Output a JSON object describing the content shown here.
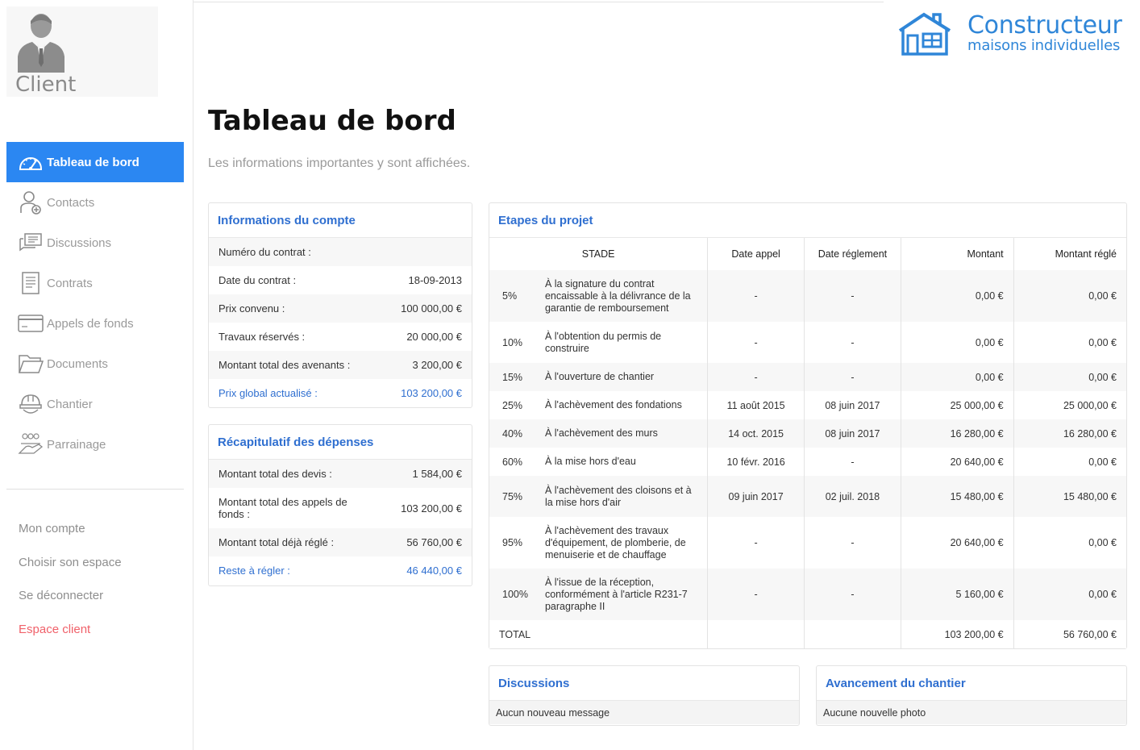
{
  "sidebar": {
    "profile_name": "Client",
    "nav": [
      {
        "label": "Tableau de bord",
        "icon": "speedometer-icon",
        "active": true
      },
      {
        "label": "Contacts",
        "icon": "user-add-icon"
      },
      {
        "label": "Discussions",
        "icon": "chat-icon"
      },
      {
        "label": "Contrats",
        "icon": "document-icon"
      },
      {
        "label": "Appels de fonds",
        "icon": "credit-card-icon"
      },
      {
        "label": "Documents",
        "icon": "folder-icon"
      },
      {
        "label": "Chantier",
        "icon": "helmet-icon"
      },
      {
        "label": "Parrainage",
        "icon": "handshake-icon"
      }
    ],
    "links": [
      {
        "label": "Mon compte"
      },
      {
        "label": "Choisir son espace"
      },
      {
        "label": "Se déconnecter"
      },
      {
        "label": "Espace client"
      }
    ]
  },
  "logo": {
    "line1": "Constructeur",
    "line2": "maisons individuelles",
    "color": "#2f86d8"
  },
  "header": {
    "title": "Tableau de bord",
    "subtitle": "Les informations importantes y sont affichées."
  },
  "account": {
    "title": "Informations du compte",
    "rows": [
      {
        "label": "Numéro du contrat :",
        "value": ""
      },
      {
        "label": "Date du contrat :",
        "value": "18-09-2013"
      },
      {
        "label": "Prix convenu :",
        "value": "100 000,00 €"
      },
      {
        "label": "Travaux réservés :",
        "value": "20 000,00 €"
      },
      {
        "label": "Montant total des avenants :",
        "value": "3 200,00 €"
      },
      {
        "label": "Prix global actualisé :",
        "value": "103 200,00 €"
      }
    ]
  },
  "expenses": {
    "title": "Récapitulatif des dépenses",
    "rows": [
      {
        "label": "Montant total des devis :",
        "value": "1 584,00 €"
      },
      {
        "label": "Montant total des appels de fonds :",
        "value": "103 200,00 €"
      },
      {
        "label": "Montant total déjà réglé :",
        "value": "56 760,00 €"
      },
      {
        "label": "Reste à régler :",
        "value": "46 440,00 €"
      }
    ]
  },
  "steps": {
    "title": "Etapes du projet",
    "headers": [
      "STADE",
      "Date appel",
      "Date réglement",
      "Montant",
      "Montant réglé"
    ],
    "rows": [
      {
        "pct": "5%",
        "stade": "À la signature du contrat encaissable à la délivrance de la garantie de remboursement",
        "date_appel": "-",
        "date_reglement": "-",
        "montant": "0,00 €",
        "regle": "0,00 €"
      },
      {
        "pct": "10%",
        "stade": "À l'obtention du permis de construire",
        "date_appel": "-",
        "date_reglement": "-",
        "montant": "0,00 €",
        "regle": "0,00 €"
      },
      {
        "pct": "15%",
        "stade": "À l'ouverture de chantier",
        "date_appel": "-",
        "date_reglement": "-",
        "montant": "0,00 €",
        "regle": "0,00 €"
      },
      {
        "pct": "25%",
        "stade": "À l'achèvement des fondations",
        "date_appel": "11 août 2015",
        "date_reglement": "08 juin 2017",
        "montant": "25 000,00 €",
        "regle": "25 000,00 €"
      },
      {
        "pct": "40%",
        "stade": "À l'achèvement des murs",
        "date_appel": "14 oct. 2015",
        "date_reglement": "08 juin 2017",
        "montant": "16 280,00 €",
        "regle": "16 280,00 €"
      },
      {
        "pct": "60%",
        "stade": "À la mise hors d'eau",
        "date_appel": "10 févr. 2016",
        "date_reglement": "-",
        "montant": "20 640,00 €",
        "regle": "0,00 €"
      },
      {
        "pct": "75%",
        "stade": "À l'achèvement des cloisons et à la mise hors d'air",
        "date_appel": "09 juin 2017",
        "date_reglement": "02 juil. 2018",
        "montant": "15 480,00 €",
        "regle": "15 480,00 €"
      },
      {
        "pct": "95%",
        "stade": "À l'achèvement des travaux d'équipement, de plomberie, de menuiserie et de chauffage",
        "date_appel": "-",
        "date_reglement": "-",
        "montant": "20 640,00 €",
        "regle": "0,00 €"
      },
      {
        "pct": "100%",
        "stade": "À l'issue de la réception, conformément à l'article R231-7 paragraphe II",
        "date_appel": "-",
        "date_reglement": "-",
        "montant": "5 160,00 €",
        "regle": "0,00 €"
      }
    ],
    "total": {
      "label": "TOTAL",
      "montant": "103 200,00 €",
      "regle": "56 760,00 €"
    }
  },
  "discussions": {
    "title": "Discussions",
    "message": "Aucun nouveau message"
  },
  "chantier": {
    "title": "Avancement du chantier",
    "message": "Aucune nouvelle photo"
  }
}
